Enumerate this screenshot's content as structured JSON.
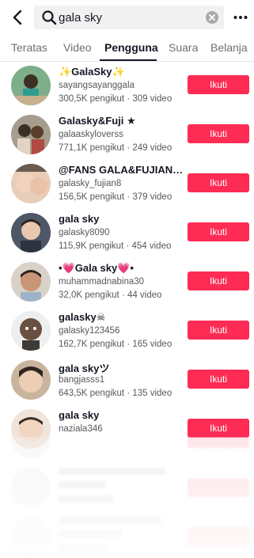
{
  "search": {
    "query": "gala sky"
  },
  "tabs": [
    {
      "label": "Teratas"
    },
    {
      "label": "Video"
    },
    {
      "label": "Pengguna"
    },
    {
      "label": "Suara"
    },
    {
      "label": "Belanja"
    }
  ],
  "users": [
    {
      "name": "✨GalaSky✨",
      "handle": "sayangsayanggala",
      "stats": "300,5K pengikut · 309 video",
      "follow": "Ikuti"
    },
    {
      "name": "Galasky&Fuji ★",
      "handle": "galaaskyloverss",
      "stats": "771,1K pengikut · 249 video",
      "follow": "Ikuti"
    },
    {
      "name": "@FANS GALA&FUJIAN…",
      "handle": "galasky_fujian8",
      "stats": "156,5K pengikut · 379 video",
      "follow": "Ikuti"
    },
    {
      "name": "gala sky",
      "handle": "galasky8090",
      "stats": "115,9K pengikut · 454 video",
      "follow": "Ikuti"
    },
    {
      "name": "•💗Gala sky💗•",
      "handle": "muhammadnabina30",
      "stats": "32,0K pengikut · 44 video",
      "follow": "Ikuti"
    },
    {
      "name": "galasky☠",
      "handle": "galasky123456",
      "stats": "162,7K pengikut · 165 video",
      "follow": "Ikuti"
    },
    {
      "name": "gala skyツ",
      "handle": "bangjasss1",
      "stats": "643,5K pengikut · 135 video",
      "follow": "Ikuti"
    },
    {
      "name": "gala sky",
      "handle": "naziala346",
      "stats": "",
      "follow": "Ikuti"
    }
  ],
  "colors": {
    "accent": "#fe2c55",
    "text_primary": "#161823",
    "text_secondary": "#57585e",
    "search_bg": "#f1f1f2"
  },
  "icons": {
    "back": "chevron-left-icon",
    "search": "search-icon",
    "clear": "clear-icon",
    "more": "more-icon"
  }
}
